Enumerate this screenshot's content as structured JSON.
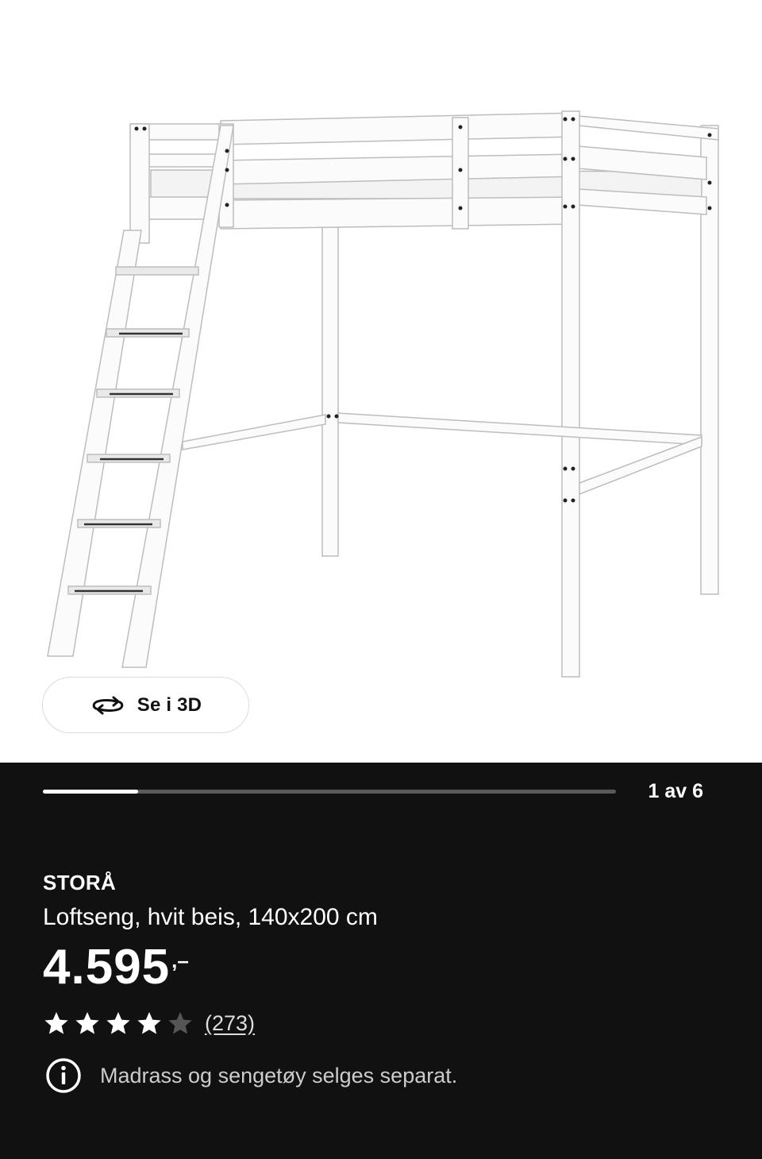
{
  "gallery": {
    "view_3d_label": "Se i 3D",
    "counter": "1 av 6",
    "progress_fraction": 0.1667,
    "icons": {
      "view_3d": "rotate-3d-icon"
    }
  },
  "product": {
    "name": "STORÅ",
    "description": "Loftseng, hvit beis, 140x200 cm",
    "price": "4.595",
    "price_suffix": ",–",
    "rating": {
      "value": 4,
      "max": 5,
      "count_label": "(273)"
    },
    "note": "Madrass og sengetøy selges separat.",
    "icons": {
      "note": "info-icon",
      "star": "star-icon"
    }
  },
  "colors": {
    "panel_background": "#111111",
    "text_primary": "#ffffff",
    "progress_track": "#5a5a5a",
    "star_filled": "#ffffff",
    "star_empty": "#555555"
  }
}
